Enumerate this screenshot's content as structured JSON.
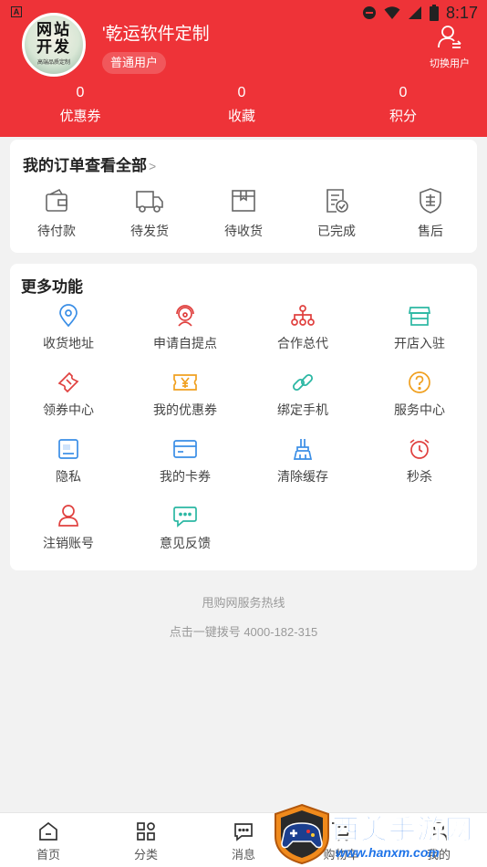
{
  "status_bar": {
    "time": "8:17",
    "notification_icon": "A"
  },
  "profile": {
    "avatar_lines": [
      "网站",
      "开发"
    ],
    "avatar_sub": "高端品质定制",
    "name": "'乾运软件定制",
    "badge": "普通用户",
    "switch_user": "切换用户"
  },
  "stats": [
    {
      "value": "0",
      "label": "优惠券"
    },
    {
      "value": "0",
      "label": "收藏"
    },
    {
      "value": "0",
      "label": "积分"
    }
  ],
  "orders": {
    "title": "我的订单查看全部",
    "chevron": ">",
    "items": [
      {
        "label": "待付款",
        "icon": "wallet-icon"
      },
      {
        "label": "待发货",
        "icon": "truck-icon"
      },
      {
        "label": "待收货",
        "icon": "package-icon"
      },
      {
        "label": "已完成",
        "icon": "document-check-icon"
      },
      {
        "label": "售后",
        "icon": "after-sale-shield-icon"
      }
    ]
  },
  "more": {
    "title": "更多功能",
    "items": [
      {
        "label": "收货地址",
        "icon": "location-pin-icon",
        "color": "#3a8ee6"
      },
      {
        "label": "申请自提点",
        "icon": "service-person-icon",
        "color": "#e0413f"
      },
      {
        "label": "合作总代",
        "icon": "org-tree-icon",
        "color": "#e0413f"
      },
      {
        "label": "开店入驻",
        "icon": "store-icon",
        "color": "#2bb7a3"
      },
      {
        "label": "领券中心",
        "icon": "ticket-icon",
        "color": "#e0413f"
      },
      {
        "label": "我的优惠券",
        "icon": "coupon-yen-icon",
        "color": "#f0a020"
      },
      {
        "label": "绑定手机",
        "icon": "link-icon",
        "color": "#2bb7a3"
      },
      {
        "label": "服务中心",
        "icon": "help-circle-icon",
        "color": "#f0a020"
      },
      {
        "label": "隐私",
        "icon": "privacy-card-icon",
        "color": "#3a8ee6"
      },
      {
        "label": "我的卡券",
        "icon": "card-icon",
        "color": "#3a8ee6"
      },
      {
        "label": "清除缓存",
        "icon": "broom-icon",
        "color": "#3a8ee6"
      },
      {
        "label": "秒杀",
        "icon": "alarm-clock-icon",
        "color": "#e0413f"
      },
      {
        "label": "注销账号",
        "icon": "user-icon",
        "color": "#e0413f"
      },
      {
        "label": "意见反馈",
        "icon": "chat-bubble-icon",
        "color": "#2bb7a3"
      }
    ]
  },
  "hotline": {
    "title": "甩购网服务热线",
    "dial_text": "点击一键拨号 4000-182-315"
  },
  "tabbar": [
    {
      "label": "首页",
      "icon": "home-icon"
    },
    {
      "label": "分类",
      "icon": "grid-icon"
    },
    {
      "label": "消息",
      "icon": "message-icon"
    },
    {
      "label": "购物车",
      "icon": "cart-icon"
    },
    {
      "label": "我的",
      "icon": "profile-icon"
    }
  ],
  "watermark": {
    "title": "西美手游网",
    "url": "www.hanxm.com"
  },
  "colors": {
    "brand": "#ee3338",
    "background": "#f2f2f2"
  }
}
